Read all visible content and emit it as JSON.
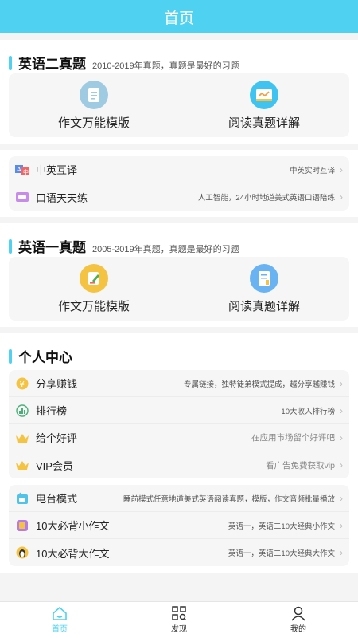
{
  "header": {
    "title": "首页"
  },
  "english2": {
    "title": "英语二真题",
    "subtitle": "2010-2019年真题，真题是最好的习题",
    "items": [
      {
        "label": "作文万能模版"
      },
      {
        "label": "阅读真题详解"
      }
    ]
  },
  "tools": [
    {
      "label": "中英互译",
      "desc": "中英实时互译"
    },
    {
      "label": "口语天天练",
      "desc": "人工智能，24小时地道美式英语口语陪练"
    }
  ],
  "english1": {
    "title": "英语一真题",
    "subtitle": "2005-2019年真题，真题是最好的习题",
    "items": [
      {
        "label": "作文万能模版"
      },
      {
        "label": "阅读真题详解"
      }
    ]
  },
  "personal": {
    "title": "个人中心",
    "items": [
      {
        "label": "分享赚钱",
        "desc": "专属链接，独特徒弟模式提成，越分享越赚钱"
      },
      {
        "label": "排行榜",
        "desc": "10大收入排行榜"
      },
      {
        "label": "给个好评",
        "desc": "在应用市场留个好评吧"
      },
      {
        "label": "VIP会员",
        "desc": "看广告免费获取vip"
      }
    ]
  },
  "extras": [
    {
      "label": "电台模式",
      "desc": "睡前模式任意地道美式英语阅读真题，模版，作文音频批量播放"
    },
    {
      "label": "10大必背小作文",
      "desc": "英语一，英语二10大经典小作文"
    },
    {
      "label": "10大必背大作文",
      "desc": "英语一，英语二10大经典大作文"
    }
  ],
  "tabbar": [
    {
      "label": "首页"
    },
    {
      "label": "发现"
    },
    {
      "label": "我的"
    }
  ],
  "colors": {
    "accent": "#4fd2f2",
    "gold": "#f5c342",
    "purple": "#b57be8"
  }
}
